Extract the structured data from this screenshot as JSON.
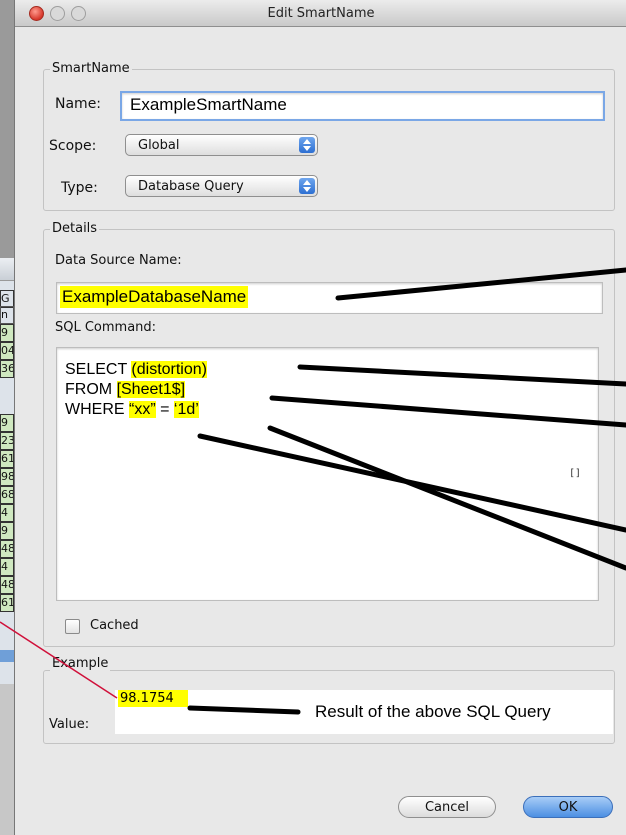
{
  "background_sheet": {
    "cells": [
      "G",
      "n",
      "9",
      "04",
      "36",
      "9",
      "23",
      "61",
      "98",
      "68",
      "4",
      "9",
      "48",
      "4",
      "48",
      "61"
    ]
  },
  "window": {
    "title": "Edit SmartName",
    "traffic_lights": [
      "close",
      "minimize",
      "zoom"
    ]
  },
  "smartname": {
    "group_label": "SmartName",
    "name_label": "Name:",
    "name_value": "ExampleSmartName",
    "scope_label": "Scope:",
    "scope_value": "Global",
    "type_label": "Type:",
    "type_value": "Database Query"
  },
  "details": {
    "group_label": "Details",
    "dsn_label": "Data Source Name:",
    "dsn_value": "ExampleDatabaseName",
    "sql_label": "SQL Command:",
    "sql": {
      "select_kw": "SELECT",
      "select_arg": "(distortion)",
      "from_kw": "FROM",
      "from_arg": "[Sheet1$]",
      "where_kw": "WHERE",
      "where_col": "“xx”",
      "where_eq": "=",
      "where_val": "‘1d’"
    },
    "resize_glyph": "[]",
    "cached_label": "Cached",
    "cached_checked": false
  },
  "example": {
    "group_label": "Example",
    "value_label": "Value:",
    "value": "98.1754",
    "annotation": "Result of the above SQL Query"
  },
  "buttons": {
    "cancel": "Cancel",
    "ok": "OK"
  },
  "colors": {
    "highlight": "#ffff00",
    "callout_line": "#000000",
    "link_line": "#d0103a"
  }
}
